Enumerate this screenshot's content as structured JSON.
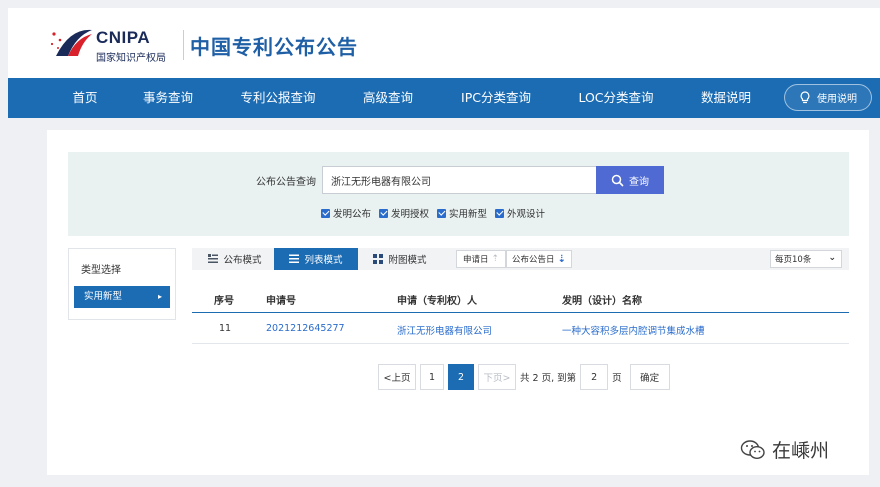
{
  "header": {
    "logo_en": "CNIPA",
    "logo_cn": "国家知识产权局",
    "site_title": "中国专利公布公告"
  },
  "nav": {
    "items": [
      "首页",
      "事务查询",
      "专利公报查询",
      "高级查询",
      "IPC分类查询",
      "LOC分类查询",
      "数据说明"
    ],
    "help_label": "使用说明"
  },
  "search": {
    "label": "公布公告查询",
    "value": "浙江无形电器有限公司",
    "button_label": "查询",
    "checkboxes": [
      {
        "label": "发明公布",
        "checked": true
      },
      {
        "label": "发明授权",
        "checked": true
      },
      {
        "label": "实用新型",
        "checked": true
      },
      {
        "label": "外观设计",
        "checked": true
      }
    ]
  },
  "sidebar": {
    "title": "类型选择",
    "selected": "实用新型"
  },
  "toolbar": {
    "modes": [
      {
        "label": "公布模式",
        "icon": "list-detail-icon",
        "active": false
      },
      {
        "label": "列表模式",
        "icon": "list-icon",
        "active": true
      },
      {
        "label": "附图模式",
        "icon": "grid-icon",
        "active": false
      }
    ],
    "sort_buttons": [
      {
        "label": "申请日",
        "icon": "sort-up-icon"
      },
      {
        "label": "公布公告日",
        "icon": "sort-down-icon"
      }
    ],
    "per_page": "每页10条"
  },
  "table": {
    "headers": [
      "序号",
      "申请号",
      "申请（专利权）人",
      "发明（设计）名称"
    ],
    "rows": [
      {
        "index": "11",
        "app_no": "2021212645277",
        "applicant": "浙江无形电器有限公司",
        "title": "一种大容积多层内腔调节集成水槽"
      }
    ]
  },
  "pagination": {
    "prev": "<上页",
    "pages": [
      "1",
      "2"
    ],
    "current": "2",
    "next": "下页>",
    "total_text": "共 2 页, 到第",
    "goto_value": "2",
    "page_suffix": "页",
    "confirm": "确定"
  },
  "watermark": {
    "text": "在嵊州",
    "icon": "wechat-icon"
  },
  "colors": {
    "nav_blue": "#1c6cb4",
    "search_button": "#4f6ad3",
    "link": "#2a6ccc",
    "search_panel_bg": "#e9f1f1"
  }
}
